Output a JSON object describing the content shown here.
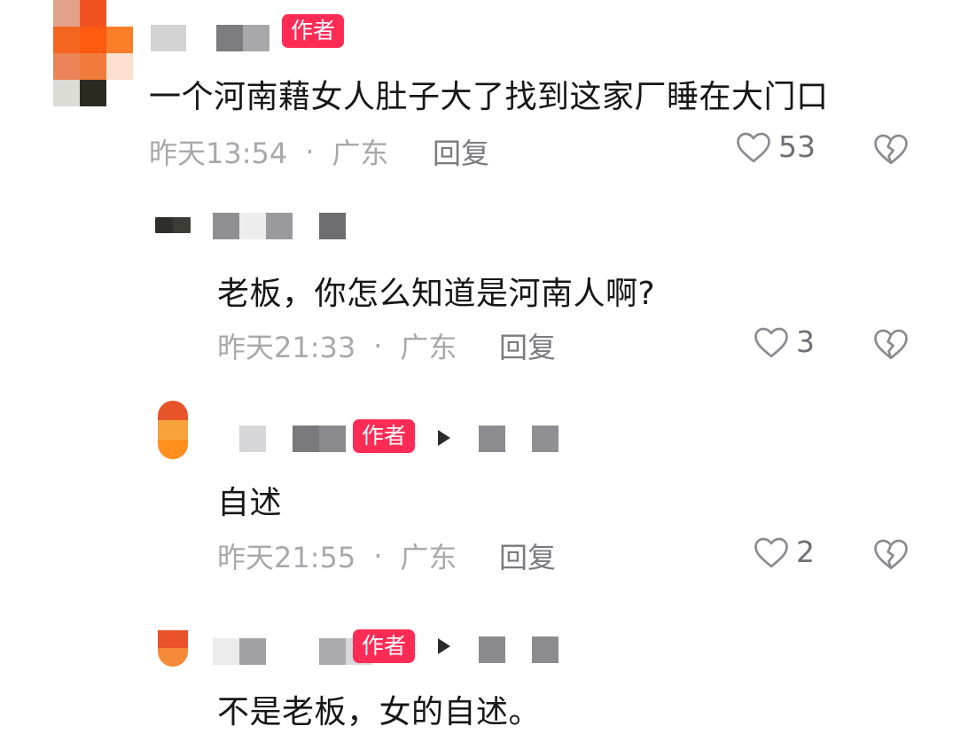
{
  "badge_label": "作者",
  "comments": [
    {
      "text": "一个河南藉女人肚子大了找到这家厂睡在大门口",
      "time": "昨天13:54",
      "separator": "·",
      "location": "广东",
      "reply_label": "回复",
      "likes": "53",
      "is_author": true
    },
    {
      "text": "老板，你怎么知道是河南人啊?",
      "time": "昨天21:33",
      "separator": "·",
      "location": "广东",
      "reply_label": "回复",
      "likes": "3",
      "is_author": false
    },
    {
      "text": "自述",
      "time": "昨天21:55",
      "separator": "·",
      "location": "广东",
      "reply_label": "回复",
      "likes": "2",
      "is_author": true
    },
    {
      "text": "不是老板，女的自述。",
      "is_author": true
    }
  ],
  "icons": {
    "like": "heart-outline-icon",
    "dislike": "broken-heart-icon",
    "reply_target": "play-arrow-icon"
  },
  "colors": {
    "author_badge": "#fe2c55",
    "meta_text": "#a8a8ad",
    "body_text": "#161616"
  }
}
